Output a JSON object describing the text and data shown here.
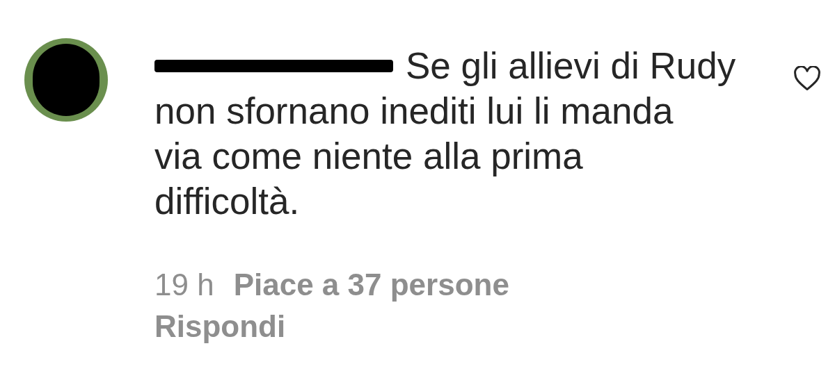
{
  "comment": {
    "lead": "Se gli allievi di Rudy",
    "text": "non sfornano inediti lui li manda\nvia come niente alla prima\ndifficoltà.",
    "liked": false
  },
  "meta": {
    "time": "19 h",
    "likes": "Piace a 37 persone",
    "reply": "Rispondi"
  }
}
